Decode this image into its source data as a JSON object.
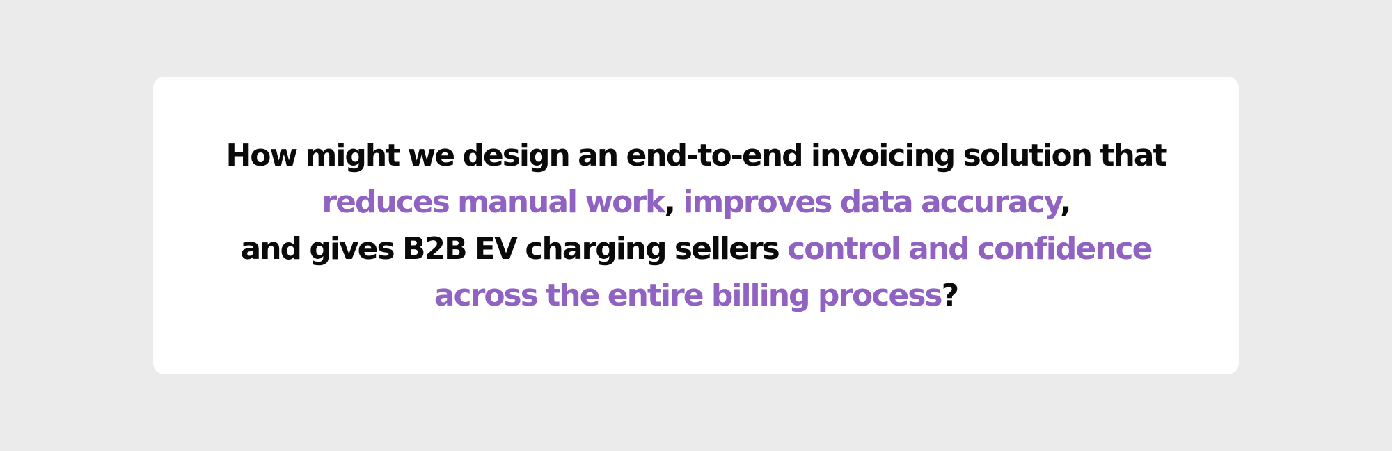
{
  "colors": {
    "page_background": "#ebebeb",
    "card_background": "#ffffff",
    "text": "#0a0a0a",
    "highlight": "#9062c2"
  },
  "statement": {
    "line1": {
      "text": "How might we design an end-to-end invoicing solution that"
    },
    "line2": {
      "highlight1": "reduces manual work",
      "separator": ", ",
      "highlight2": "improves data accuracy",
      "trailing": ","
    },
    "line3": {
      "text": "and gives B2B EV charging sellers ",
      "highlight": "control and confidence"
    },
    "line4": {
      "highlight": "across the entire billing process",
      "trailing": "?"
    }
  }
}
